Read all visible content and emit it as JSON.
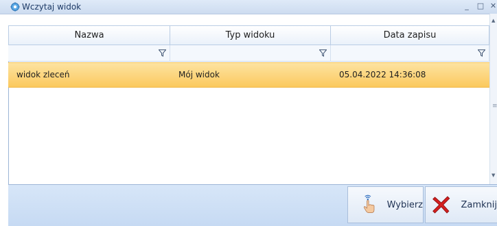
{
  "window": {
    "title": "Wczytaj widok",
    "minimize_glyph": "_",
    "maximize_glyph": "□",
    "close_glyph": "✕"
  },
  "grid": {
    "columns": [
      "Nazwa",
      "Typ widoku",
      "Data zapisu"
    ],
    "rows": [
      [
        "widok zleceń",
        "Mój widok",
        "05.04.2022 14:36:08"
      ]
    ]
  },
  "buttons": {
    "select_label": "Wybierz",
    "close_label": "Zamknij"
  },
  "icons": {
    "app": "gear-icon",
    "filter": "funnel-icon",
    "select": "hand-pointer-icon",
    "close": "red-x-icon"
  },
  "colors": {
    "selected_row": "#fbc95e",
    "title_text": "#1d3a66",
    "close_icon": "#d52020",
    "panel": "#c6daf3"
  }
}
